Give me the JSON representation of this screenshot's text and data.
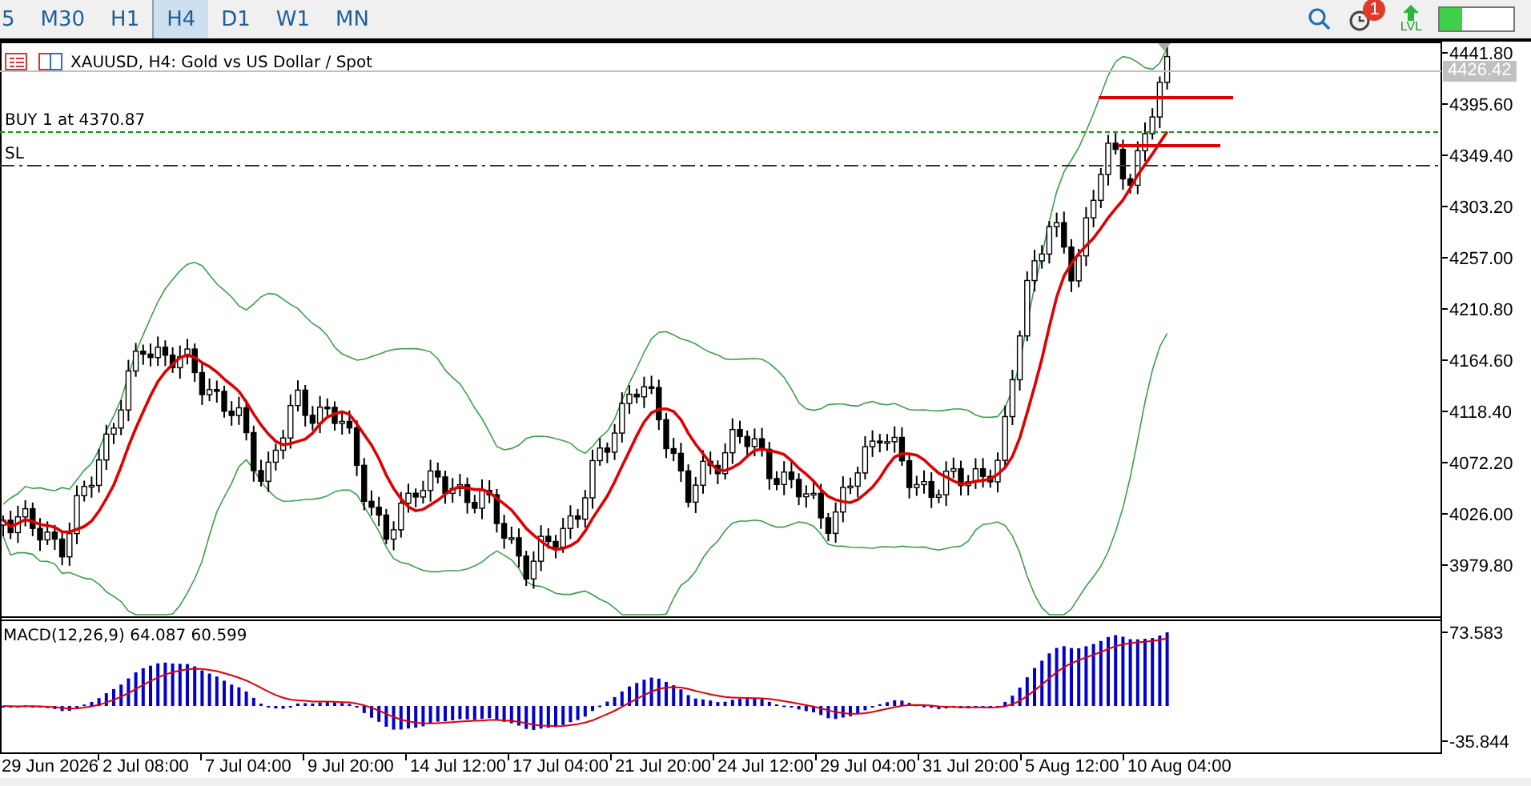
{
  "toolbar": {
    "timeframes": [
      {
        "label": "5",
        "selected": false
      },
      {
        "label": "M30",
        "selected": false
      },
      {
        "label": "H1",
        "selected": false
      },
      {
        "label": "H4",
        "selected": true
      },
      {
        "label": "D1",
        "selected": false
      },
      {
        "label": "W1",
        "selected": false
      },
      {
        "label": "MN",
        "selected": false
      }
    ],
    "alerts_badge": "1",
    "lvl_label": "LVL",
    "meter": {
      "level": 0.3
    }
  },
  "chart": {
    "title": "XAUUSD, H4:  Gold vs US Dollar / Spot",
    "price_lines": [
      {
        "kind": "bid",
        "label": "4426.42"
      },
      {
        "kind": "order",
        "label": "BUY 1 at 4370.87"
      },
      {
        "kind": "stop",
        "label": "SL"
      }
    ],
    "price_axis": [
      "4441.80",
      "4395.60",
      "4349.40",
      "4303.20",
      "4257.00",
      "4210.80",
      "4164.60",
      "4118.40",
      "4072.20",
      "4026.00",
      "3979.80"
    ],
    "indicator": {
      "label": "MACD(12,26,9) 64.087 60.599",
      "axis": [
        "73.583",
        "-35.844"
      ]
    },
    "time_axis": [
      "29 Jun 2026",
      "2 Jul 08:00",
      "7 Jul 04:00",
      "9 Jul 20:00",
      "14 Jul 12:00",
      "17 Jul 04:00",
      "21 Jul 20:00",
      "24 Jul 12:00",
      "29 Jul 04:00",
      "31 Jul 20:00",
      "5 Aug 12:00",
      "10 Aug 04:00"
    ]
  }
}
